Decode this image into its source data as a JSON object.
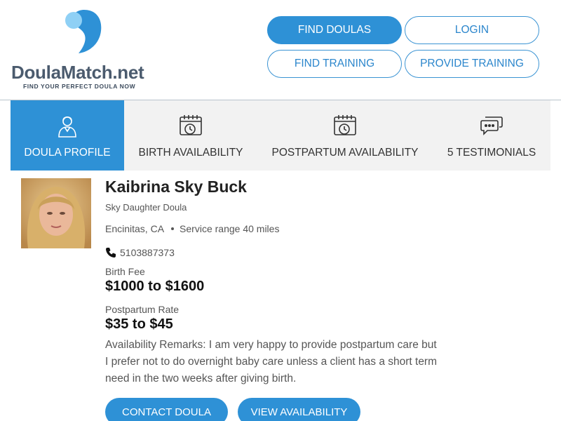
{
  "logo": {
    "brand_main": "DoulaMatch",
    "brand_suffix": ".net",
    "tagline": "FIND YOUR PERFECT DOULA NOW",
    "accent_color": "#2e91d6"
  },
  "nav": {
    "find_doulas": "FIND DOULAS",
    "login": "LOGIN",
    "find_training": "FIND TRAINING",
    "provide_training": "PROVIDE TRAINING"
  },
  "tabs": [
    {
      "label": "DOULA PROFILE",
      "icon": "person-icon",
      "active": true
    },
    {
      "label": "BIRTH AVAILABILITY",
      "icon": "calendar-clock-icon",
      "active": false
    },
    {
      "label": "POSTPARTUM AVAILABILITY",
      "icon": "calendar-clock-icon",
      "active": false
    },
    {
      "label": "5 TESTIMONIALS",
      "icon": "chat-bubbles-icon",
      "active": false
    }
  ],
  "profile": {
    "name": "Kaibrina Sky Buck",
    "business": "Sky Daughter Doula",
    "location": "Encinitas, CA",
    "service_range": "Service range 40 miles",
    "phone": "5103887373",
    "birth_fee_label": "Birth Fee",
    "birth_fee": "$1000 to $1600",
    "pp_rate_label": "Postpartum Rate",
    "pp_rate": "$35 to $45",
    "remarks": "Availability Remarks: I am very happy to provide postpartum care but I prefer not to do overnight baby care unless a client has a short term need in the two weeks after giving birth."
  },
  "actions": {
    "contact": "CONTACT DOULA",
    "view_availability": "VIEW AVAILABILITY"
  }
}
